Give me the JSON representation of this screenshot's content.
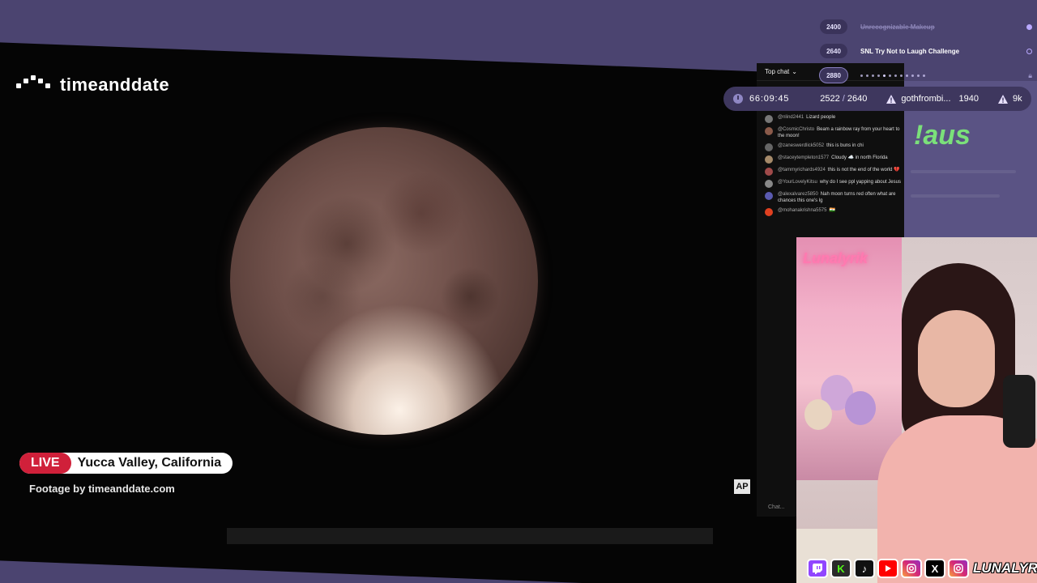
{
  "video": {
    "logo_text": "timeanddate",
    "live_label": "LIVE",
    "location": "Yucca Valley, California",
    "footage_credit": "Footage by timeanddate.com",
    "watermark": "AP"
  },
  "chat": {
    "header": "Top chat",
    "input_placeholder": "Chat...",
    "messages": [
      {
        "user": "@nlind2441",
        "text": "Lizard people",
        "color": "#777777"
      },
      {
        "user": "@CosmicChristo",
        "text": "Beam a rainbow ray from your heart to the moon!",
        "color": "#8a5a4a"
      },
      {
        "user": "@zaneswerdlick5052",
        "text": "this is buns in chi",
        "color": "#666666"
      },
      {
        "user": "@staceytempleton1577",
        "text": "Cloudy ☁️ in north Florida",
        "color": "#a58a6a"
      },
      {
        "user": "@tammyrichards4924",
        "text": "this is not the end of the world 💔",
        "color": "#a04a4a"
      },
      {
        "user": "@YourLovelyKitsu",
        "text": "why do I see ppl yapping about Jesus",
        "color": "#888888"
      },
      {
        "user": "@alexalvarez5850",
        "text": "Nah moon turns red often what are chances this one's lg",
        "color": "#5a5ab0"
      },
      {
        "user": "@mohanakrishna5575",
        "text": "🇮🇳",
        "color": "#e04020"
      }
    ]
  },
  "queue": [
    {
      "number": "2400",
      "title": "Unrecognizable Makeup",
      "state": "done"
    },
    {
      "number": "2640",
      "title": "SNL Try Not to Laugh Challenge",
      "state": "current"
    },
    {
      "number": "2880",
      "title": "",
      "state": "locked"
    }
  ],
  "stats": {
    "timer": "66:09:45",
    "count_current": "2522",
    "count_separator": "/",
    "count_target": "2640",
    "top_user": "gothfrombi...",
    "top_user_score": "1940",
    "extra_count": "9k"
  },
  "overlay": {
    "pause_text": "!aus"
  },
  "webcam": {
    "neon_sign": "Lunalyrik"
  },
  "socials": {
    "icons": [
      "twitch-icon",
      "kick-icon",
      "tiktok-icon",
      "youtube-icon",
      "instagram-icon",
      "x-icon",
      "instagram-icon"
    ],
    "kick_letter": "K",
    "x_letter": "X",
    "handle": "LUNALYRIK"
  },
  "colors": {
    "background": "#4b4470",
    "live_red": "#d0203a",
    "stat_bar": "#3e375e",
    "pause_green": "#7be07a"
  }
}
